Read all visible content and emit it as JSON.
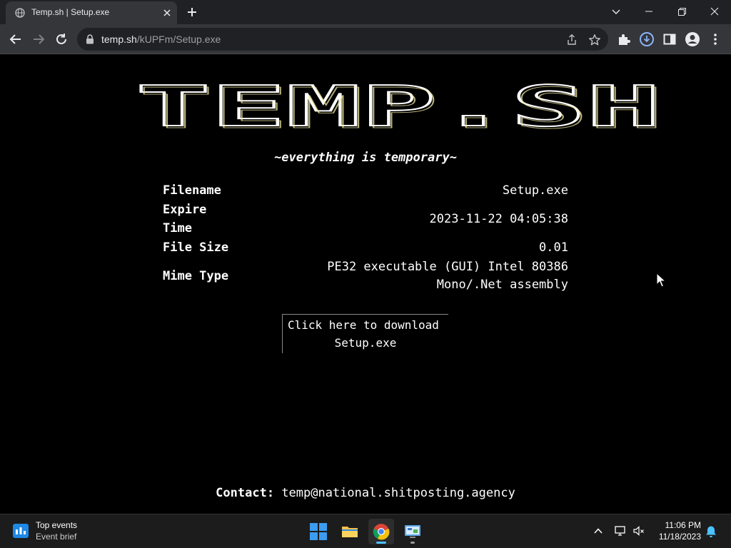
{
  "browser": {
    "tab": {
      "title": "Temp.sh | Setup.exe",
      "favicon": "globe-icon"
    },
    "address": {
      "host": "temp.sh",
      "path": "/kUPFm/Setup.exe"
    },
    "accent_color": "#8ab4f8"
  },
  "page": {
    "logo": "TEMP.SH",
    "tagline": "~everything is temporary~",
    "file_info": {
      "filename_label": "Filename",
      "filename_value": "Setup.exe",
      "expire_label_line1": "Expire",
      "expire_label_line2": "Time",
      "expire_value": "2023-11-22 04:05:38",
      "size_label": "File Size",
      "size_value": "0.01",
      "mime_label": "Mime Type",
      "mime_value_line1": "PE32 executable (GUI) Intel 80386",
      "mime_value_line2": "Mono/.Net assembly"
    },
    "download": {
      "line1": "Click here to download",
      "line2": "Setup.exe"
    },
    "contact": {
      "label": "Contact:",
      "email": "temp@national.shitposting.agency"
    },
    "background_color": "#000000",
    "text_color": "#ffffff"
  },
  "taskbar": {
    "widget": {
      "title": "Top events",
      "subtitle": "Event brief"
    },
    "apps": [
      "windows-start-icon",
      "file-explorer-icon",
      "chrome-icon",
      "control-panel-icon"
    ],
    "clock": {
      "time": "11:06 PM",
      "date": "11/18/2023"
    }
  }
}
